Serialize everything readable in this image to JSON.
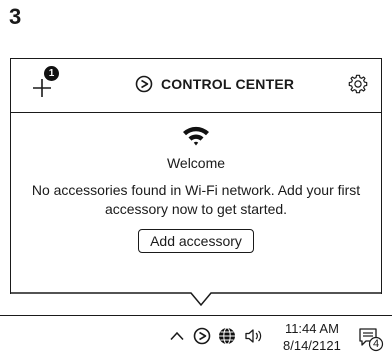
{
  "step": {
    "number": "3"
  },
  "header": {
    "title": "CONTROL CENTER",
    "badge_count": "1",
    "icons": [
      "plus-icon",
      "elgato-logo-icon",
      "gear-icon"
    ]
  },
  "main": {
    "welcome": "Welcome",
    "message": "No accessories found in Wi-Fi network. Add your first accessory now to get started.",
    "add_button_label": "Add accessory",
    "icons": [
      "wifi-icon"
    ]
  },
  "taskbar": {
    "time": "11:44 AM",
    "date": "8/14/2121",
    "notification_count": "4",
    "icons": [
      "chevron-up-icon",
      "elgato-tray-icon",
      "network-globe-icon",
      "speaker-icon",
      "notification-icon"
    ]
  },
  "colors": {
    "stroke": "#1a1a1a",
    "background": "#ffffff"
  }
}
